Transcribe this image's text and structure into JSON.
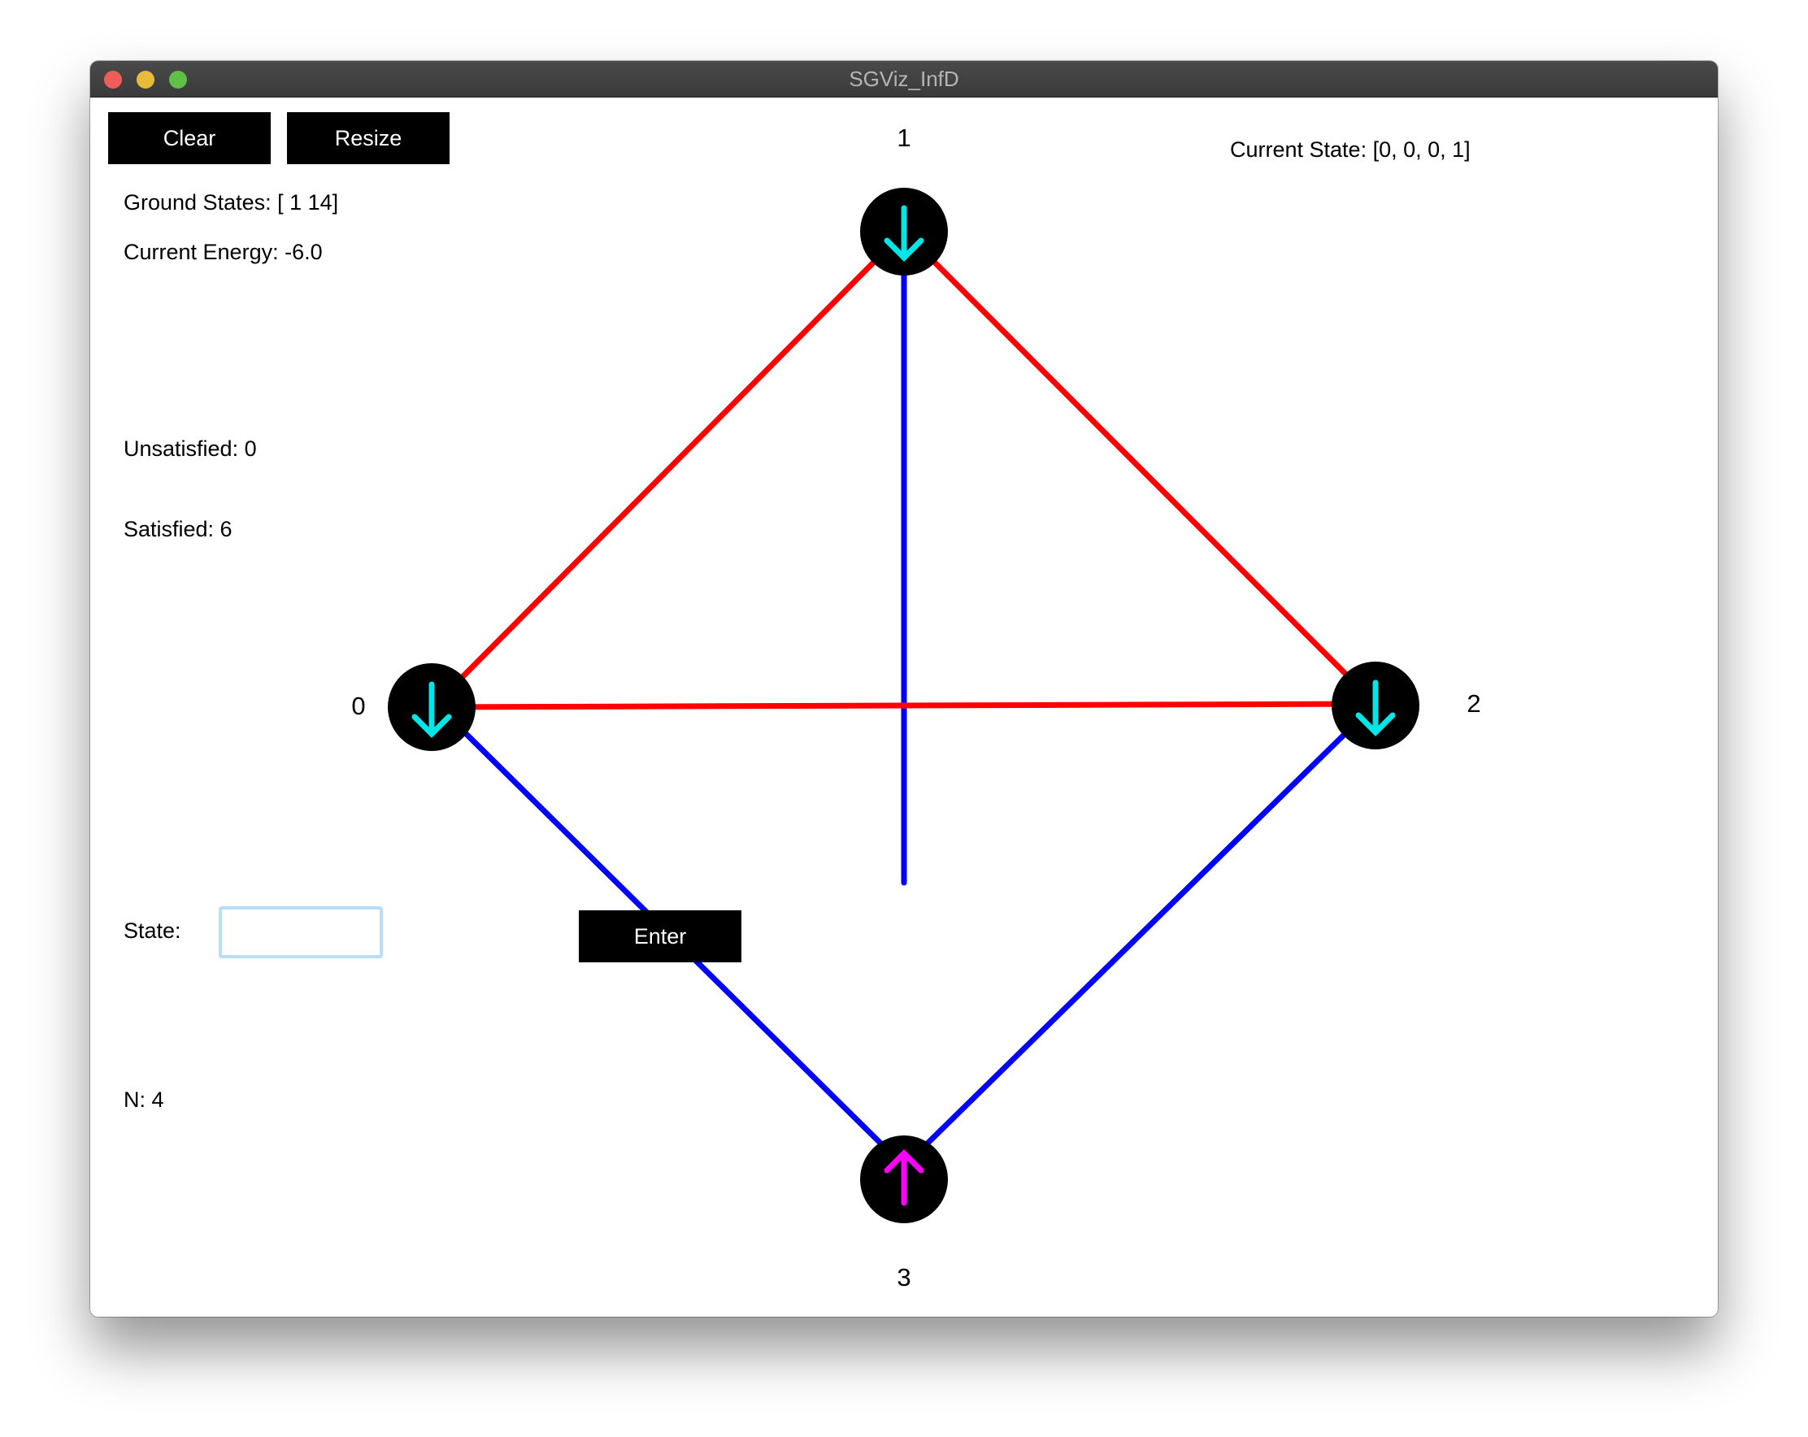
{
  "window": {
    "title": "SGViz_InfD"
  },
  "toolbar": {
    "clear_label": "Clear",
    "resize_label": "Resize"
  },
  "info": {
    "ground_states": "Ground States: [ 1 14]",
    "current_energy": "Current Energy: -6.0",
    "unsatisfied": "Unsatisfied: 0",
    "satisfied": "Satisfied: 6",
    "n": "N: 4",
    "current_state": "Current State: [0, 0, 0, 1]"
  },
  "state_entry": {
    "label": "State:",
    "value": "",
    "enter_label": "Enter"
  },
  "graph": {
    "colors": {
      "satisfied_edge_red": "#ff0000",
      "satisfied_edge_blue": "#0000ff",
      "node_fill": "#000000",
      "spin_down": "#00e5e5",
      "spin_up": "#ff00ff"
    },
    "nodes": [
      {
        "label": "0",
        "spin": "down"
      },
      {
        "label": "1",
        "spin": "down"
      },
      {
        "label": "2",
        "spin": "down"
      },
      {
        "label": "3",
        "spin": "up"
      }
    ],
    "edges": [
      {
        "from": "0",
        "to": "1",
        "color": "red"
      },
      {
        "from": "1",
        "to": "2",
        "color": "red"
      },
      {
        "from": "0",
        "to": "2",
        "color": "red"
      },
      {
        "from": "1",
        "to": "3",
        "color": "blue"
      },
      {
        "from": "0",
        "to": "3",
        "color": "blue"
      },
      {
        "from": "2",
        "to": "3",
        "color": "blue"
      }
    ]
  }
}
